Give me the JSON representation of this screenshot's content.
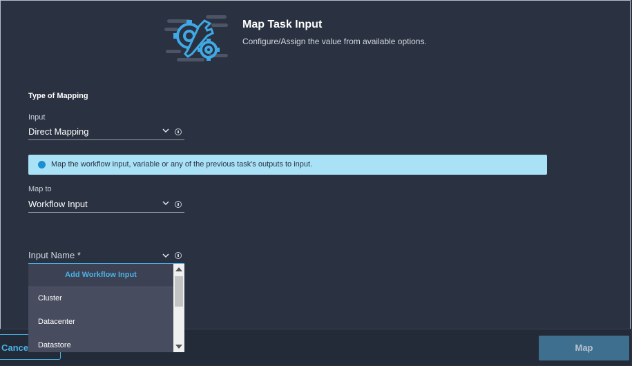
{
  "header": {
    "title": "Map Task Input",
    "subtitle": "Configure/Assign the value from available options.",
    "icon": "gear-wrench-icon"
  },
  "form": {
    "section_title": "Type of Mapping",
    "input": {
      "label": "Input",
      "value": "Direct Mapping"
    },
    "banner": {
      "text": "Map the workflow input, variable or any of the previous task's outputs to input."
    },
    "map_to": {
      "label": "Map to",
      "value": "Workflow Input"
    },
    "input_name": {
      "placeholder": "Input Name *"
    }
  },
  "dropdown": {
    "add_label": "Add Workflow Input",
    "items": [
      "Cluster",
      "Datacenter",
      "Datastore"
    ]
  },
  "footer": {
    "cancel_label": "Cancel",
    "map_label": "Map"
  },
  "colors": {
    "background": "#2a3140",
    "accent": "#4ab3e8",
    "banner": "#a9e2f7"
  }
}
